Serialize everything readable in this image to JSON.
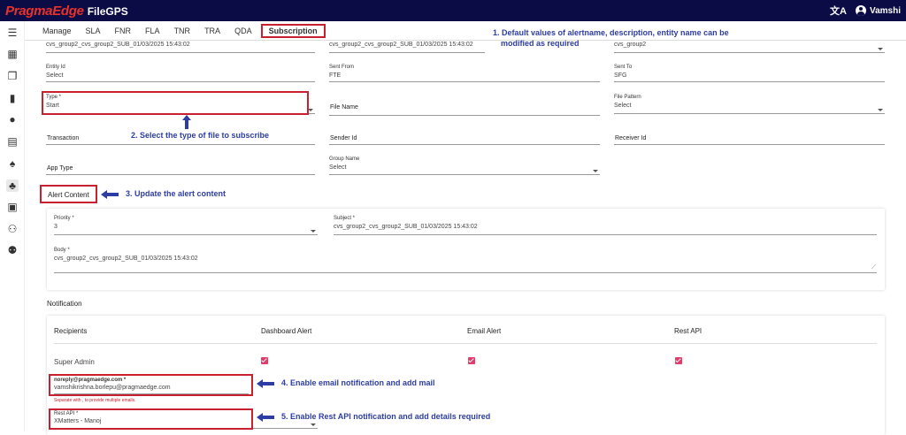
{
  "header": {
    "brand": "PragmaEdge",
    "app": "FileGPS",
    "user": "Vamshi"
  },
  "tabs": [
    "Manage",
    "SLA",
    "FNR",
    "FLA",
    "TNR",
    "TRA",
    "QDA",
    "Subscription"
  ],
  "form": {
    "alert_name": "cvs_group2_cvs_group2_SUB_01/03/2025 15:43:02",
    "description": "cvs_group2_cvs_group2_SUB_01/03/2025 15:43:02",
    "entity_name": "cvs_group2",
    "entity_id": {
      "label": "Entity Id",
      "value": "Select"
    },
    "sent_from": {
      "label": "Sent From",
      "value": "FTE"
    },
    "sent_to": {
      "label": "Sent To",
      "value": "SFG"
    },
    "type": {
      "label": "Type *",
      "value": "Start"
    },
    "file_name": "File Name",
    "file_pattern": {
      "label": "File Pattern",
      "value": "Select"
    },
    "transaction": "Transaction",
    "sender_id": "Sender Id",
    "receiver_id": "Receiver Id",
    "app_type": "App Type",
    "group_name": {
      "label": "Group Name",
      "value": "Select"
    }
  },
  "alert_content": {
    "title": "Alert Content",
    "priority": {
      "label": "Priority *",
      "value": "3"
    },
    "subject": {
      "label": "Subject *",
      "value": "cvs_group2_cvs_group2_SUB_01/03/2025 15:43:02"
    },
    "body": {
      "label": "Body *",
      "value": "cvs_group2_cvs_group2_SUB_01/03/2025 15:43:02"
    }
  },
  "notification": {
    "title": "Notification",
    "columns": [
      "Recipients",
      "Dashboard Alert",
      "Email Alert",
      "Rest API"
    ],
    "row_label": "Super Admin",
    "email": {
      "label": "noreply@pragmaedge.com *",
      "value": "vamshikrishna.borlepu@pragmaedge.com",
      "hint": "Separate with , to provide multiple emails."
    },
    "rest_api": {
      "label": "Rest API *",
      "value": "XMatters - Manoj"
    }
  },
  "annotations": {
    "note1a": "1. Default values of alertname, description, entity name can be",
    "note1b": "modified as required",
    "note2": "2. Select the type of file to subscribe",
    "note3": "3. Update the alert content",
    "note4": "4. Enable email notification and add mail",
    "note5": "5. Enable Rest API notification and add details required"
  },
  "colors": {
    "topbar": "#0b0b45",
    "brand": "#e8322b",
    "highlight": "#c8202f",
    "annotation": "#2d3da3",
    "checkbox": "#e23b6a"
  }
}
